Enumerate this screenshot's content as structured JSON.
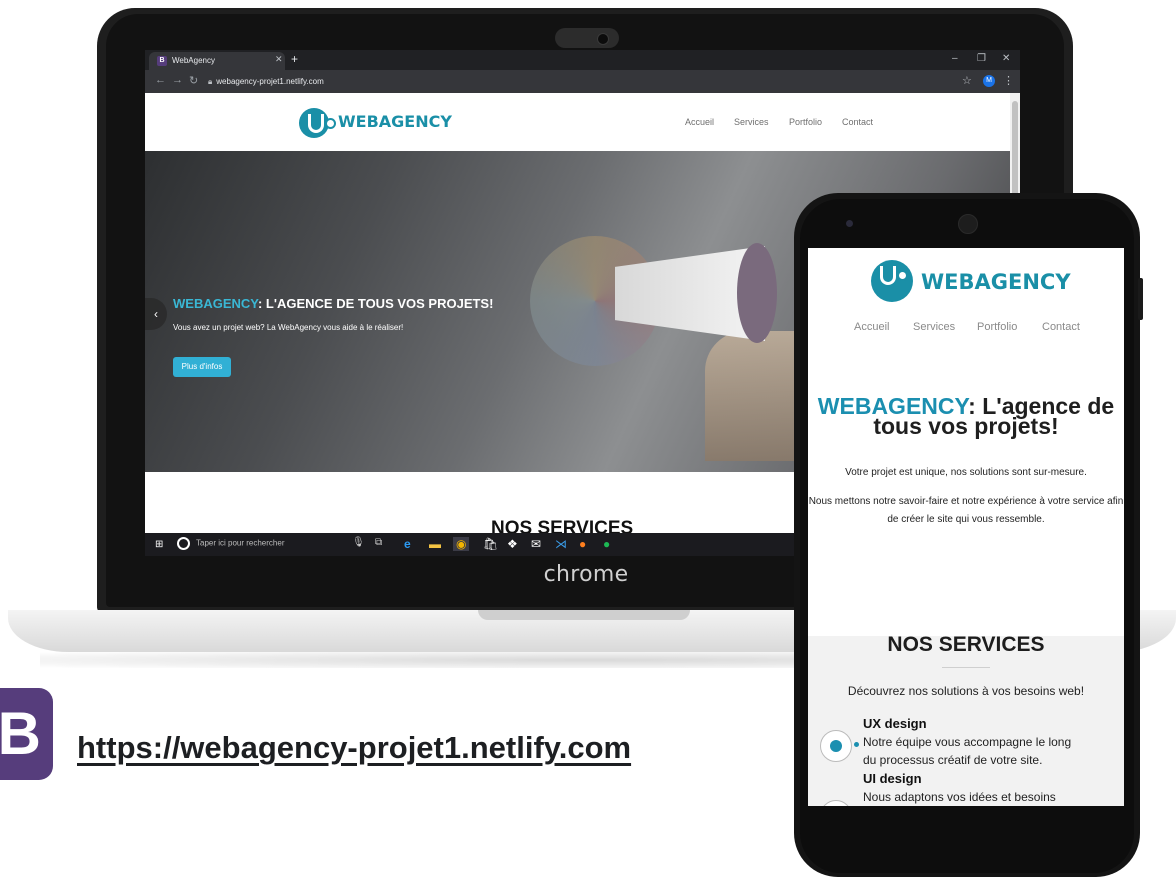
{
  "browser": {
    "tab_title": "WebAgency",
    "tab_favicon": "B",
    "url": "webagency-projet1.netlify.com",
    "profile_initial": "M",
    "icons": [
      "back-icon",
      "forward-icon",
      "reload-icon",
      "lock-icon",
      "star-icon",
      "kebab-menu-icon"
    ]
  },
  "site": {
    "logo_text": "WEBAGENCY",
    "nav": [
      "Accueil",
      "Services",
      "Portfolio",
      "Contact"
    ],
    "hero": {
      "title_accent": "WEBAGENCY",
      "title_rest": ": L'AGENCE DE TOUS VOS PROJETS!",
      "subtitle": "Vous avez un projet web? La WebAgency vous aide à le réaliser!",
      "button": "Plus d'infos"
    },
    "services_heading": "NOS SERVICES"
  },
  "taskbar": {
    "search_placeholder": "Taper ici pour rechercher"
  },
  "laptop_brand": "chrome",
  "phone": {
    "logo_text": "WEBAGENCY",
    "nav": [
      "Accueil",
      "Services",
      "Portfolio",
      "Contact"
    ],
    "title_accent": "WEBAGENCY",
    "title_rest_line1": ": L'agence de",
    "title_line2": "tous vos projets!",
    "text1": "Votre projet est unique, nos solutions sont sur-mesure.",
    "text2_line1": "Nous mettons notre savoir-faire et notre expérience à votre service afin",
    "text2_line2": "de créer le site qui vous ressemble.",
    "services_heading": "NOS SERVICES",
    "services_sub": "Découvrez nos solutions à vos besoins web!",
    "services": [
      {
        "title": "UX design",
        "line1": "Notre équipe vous accompagne le long",
        "line2": "du processus créatif de votre site."
      },
      {
        "title": "UI design",
        "line1": "Nous adaptons vos idées et besoins",
        "line2": ""
      }
    ]
  },
  "bootstrap_letter": "B",
  "link_url": "https://webagency-projet1.netlify.com",
  "colors": {
    "accent": "#1a8fa7",
    "bootstrap": "#563d7c",
    "button": "#31b0d5"
  }
}
